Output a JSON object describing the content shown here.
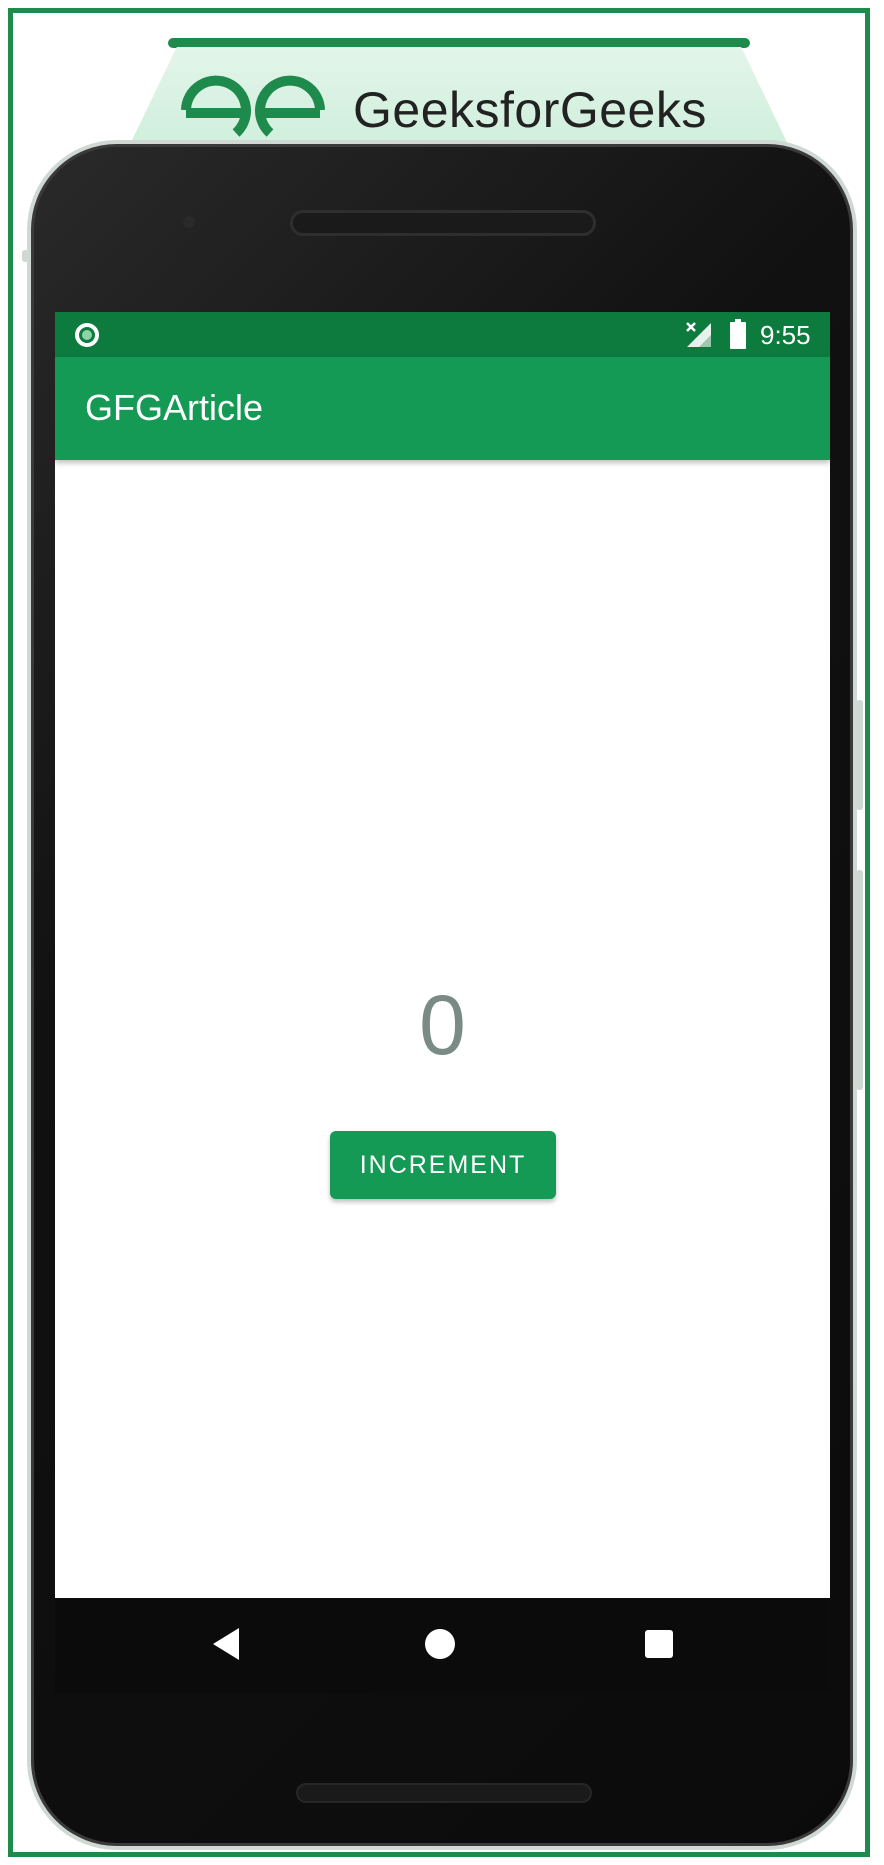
{
  "brand": {
    "name": "GeeksforGeeks",
    "logo_icon": "gfg-logo-icon",
    "color": "#1e8a4c"
  },
  "status_bar": {
    "time": "9:55",
    "icons": [
      "status-circle-icon",
      "signal-off-icon",
      "battery-icon"
    ],
    "color": "#0d7a3e"
  },
  "app_bar": {
    "title": "GFGArticle",
    "color": "#149a54"
  },
  "main": {
    "counter_value": "0",
    "increment_label": "INCREMENT"
  },
  "nav_bar": {
    "icons": [
      "back-icon",
      "home-icon",
      "recents-icon"
    ]
  }
}
